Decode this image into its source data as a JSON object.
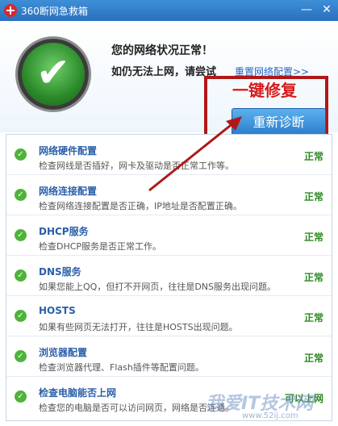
{
  "window": {
    "title": "360断网急救箱",
    "minimize": "—",
    "close": "✕"
  },
  "status": {
    "line1": "您的网络状况正常！",
    "line2": "如仍无法上网，请尝试",
    "reset_link": "重置网络配置>>"
  },
  "callout": "一键修复",
  "rediagnose_label": "重新诊断",
  "badge_mark": "✔",
  "items": [
    {
      "title": "网络硬件配置",
      "desc": "检查网线是否插好，网卡及驱动是否正常工作等。",
      "status": "正常"
    },
    {
      "title": "网络连接配置",
      "desc": "检查网络连接配置是否正确，IP地址是否配置正确。",
      "status": "正常"
    },
    {
      "title": "DHCP服务",
      "desc": "检查DHCP服务是否正常工作。",
      "status": "正常"
    },
    {
      "title": "DNS服务",
      "desc": "如果您能上QQ，但打不开网页，往往是DNS服务出现问题。",
      "status": "正常"
    },
    {
      "title": "HOSTS",
      "desc": "如果有些网页无法打开，往往是HOSTS出现问题。",
      "status": "正常"
    },
    {
      "title": "浏览器配置",
      "desc": "检查浏览器代理、Flash插件等配置问题。",
      "status": "正常"
    },
    {
      "title": "检查电脑能否上网",
      "desc": "检查您的电脑是否可以访问网页，网络是否连通。",
      "status": "可以上网"
    }
  ],
  "watermark": {
    "text": "我爱IT技术网",
    "url": "www.52ij.com"
  }
}
